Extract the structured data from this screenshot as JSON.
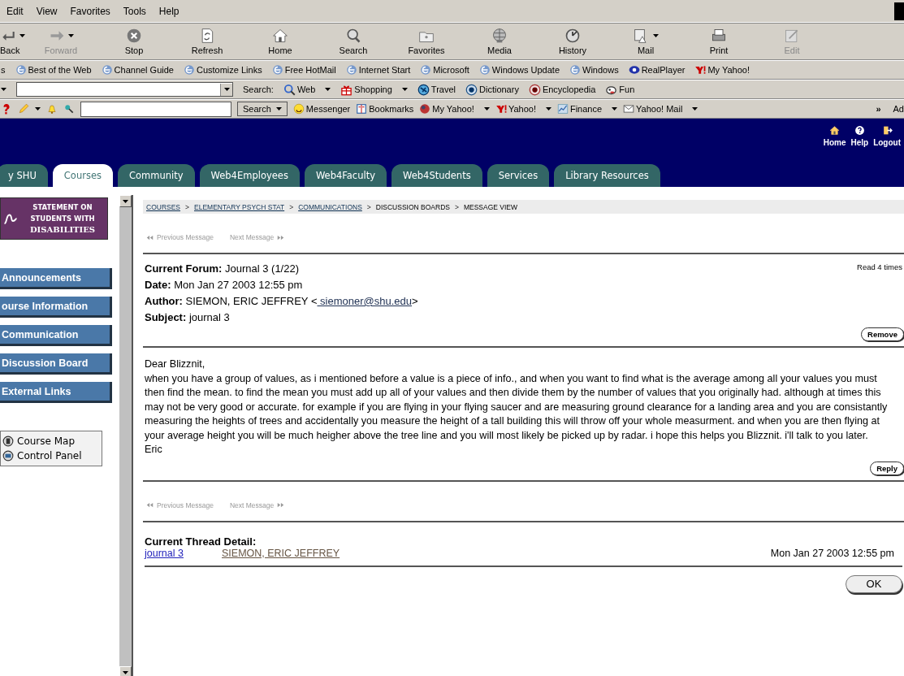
{
  "menu": [
    {
      "label": "Edit"
    },
    {
      "label": "View"
    },
    {
      "label": "Favorites"
    },
    {
      "label": "Tools"
    },
    {
      "label": "Help"
    }
  ],
  "toolbar": [
    {
      "label": "Back",
      "kind": "back",
      "disabled": false,
      "dropdown": true
    },
    {
      "label": "Forward",
      "kind": "forward",
      "disabled": true,
      "dropdown": true
    },
    {
      "label": "Stop",
      "kind": "stop",
      "disabled": false,
      "dropdown": false
    },
    {
      "label": "Refresh",
      "kind": "refresh",
      "disabled": false,
      "dropdown": false
    },
    {
      "label": "Home",
      "kind": "home",
      "disabled": false,
      "dropdown": false
    },
    {
      "label": "Search",
      "kind": "search",
      "disabled": false,
      "dropdown": false
    },
    {
      "label": "Favorites",
      "kind": "favorites",
      "disabled": false,
      "dropdown": false
    },
    {
      "label": "Media",
      "kind": "media",
      "disabled": false,
      "dropdown": false
    },
    {
      "label": "History",
      "kind": "history",
      "disabled": false,
      "dropdown": false
    },
    {
      "label": "Mail",
      "kind": "mail",
      "disabled": false,
      "dropdown": true
    },
    {
      "label": "Print",
      "kind": "print",
      "disabled": false,
      "dropdown": false
    },
    {
      "label": "Edit",
      "kind": "edit",
      "disabled": true,
      "dropdown": false
    }
  ],
  "links_bar": {
    "label": "s",
    "items": [
      {
        "label": "Best of the Web",
        "kind": "ie"
      },
      {
        "label": "Channel Guide",
        "kind": "ie"
      },
      {
        "label": "Customize Links",
        "kind": "ie"
      },
      {
        "label": "Free HotMail",
        "kind": "ie"
      },
      {
        "label": "Internet Start",
        "kind": "ie"
      },
      {
        "label": "Microsoft",
        "kind": "ie"
      },
      {
        "label": "Windows Update",
        "kind": "ie"
      },
      {
        "label": "Windows",
        "kind": "ie"
      },
      {
        "label": "RealPlayer",
        "kind": "real"
      },
      {
        "label": "My Yahoo!",
        "kind": "yahoo"
      }
    ]
  },
  "search_bar": {
    "label": "Search:",
    "items": [
      {
        "label": "Web",
        "kind": "magnifier",
        "dropdown": true
      },
      {
        "label": "Shopping",
        "kind": "gift",
        "dropdown": true
      },
      {
        "label": "Travel",
        "kind": "plane",
        "dropdown": false
      },
      {
        "label": "Dictionary",
        "kind": "dict",
        "dropdown": false
      },
      {
        "label": "Encyclopedia",
        "kind": "ency",
        "dropdown": false
      },
      {
        "label": "Fun",
        "kind": "fun",
        "dropdown": false
      }
    ]
  },
  "yahoo_bar": {
    "button": "Search",
    "items": [
      {
        "label": "Messenger",
        "kind": "smiley",
        "dropdown": false
      },
      {
        "label": "Bookmarks",
        "kind": "book",
        "dropdown": false
      },
      {
        "label": "My Yahoo!",
        "kind": "ball",
        "dropdown": true
      },
      {
        "label": "Yahoo!",
        "kind": "yahoo",
        "dropdown": true
      },
      {
        "label": "Finance",
        "kind": "finance",
        "dropdown": true
      },
      {
        "label": "Yahoo! Mail",
        "kind": "envelope",
        "dropdown": true
      }
    ],
    "more": "»",
    "cut": "Ad"
  },
  "portal": {
    "tabs": [
      {
        "label": "y SHU",
        "selected": false
      },
      {
        "label": "Courses",
        "selected": true
      },
      {
        "label": "Community",
        "selected": false
      },
      {
        "label": "Web4Employees",
        "selected": false
      },
      {
        "label": "Web4Faculty",
        "selected": false
      },
      {
        "label": "Web4Students",
        "selected": false
      },
      {
        "label": "Services",
        "selected": false
      },
      {
        "label": "Library Resources",
        "selected": false
      }
    ],
    "header_links": [
      {
        "label": "Home",
        "kind": "house"
      },
      {
        "label": "Help",
        "kind": "help"
      },
      {
        "label": "Logout",
        "kind": "logout"
      }
    ]
  },
  "sidebar": {
    "banner": [
      "STATEMENT ON",
      "STUDENTS WITH",
      "DISABILITIES"
    ],
    "nav": [
      {
        "label": "Announcements"
      },
      {
        "label": "ourse Information"
      },
      {
        "label": "Communication"
      },
      {
        "label": "Discussion Board"
      },
      {
        "label": "External Links"
      }
    ],
    "tools": [
      {
        "label": "Course Map",
        "kind": "map"
      },
      {
        "label": "Control Panel",
        "kind": "panel"
      }
    ]
  },
  "breadcrumb": [
    {
      "label": "COURSES",
      "link": true
    },
    {
      "sep": ">",
      "label": "ELEMENTARY PSYCH STAT",
      "link": true
    },
    {
      "sep": ">",
      "label": "COMMUNICATIONS",
      "link": true
    },
    {
      "sep": ">",
      "label": "DISCUSSION BOARDS",
      "link": false
    },
    {
      "sep": ">",
      "label": "MESSAGE VIEW",
      "link": false
    }
  ],
  "pager_top": [
    {
      "label": "Previous Message",
      "kind": "prev",
      "disabled": true
    },
    {
      "label": "Next Message",
      "kind": "next",
      "disabled": true
    }
  ],
  "message": {
    "fields": [
      {
        "label": "Current Forum:",
        "value": "Journal 3 (1/22)"
      },
      {
        "label": "Date:",
        "value": "Mon Jan 27 2003 12:55 pm"
      },
      {
        "label": "Author:",
        "value": "SIEMON, ERIC JEFFREY <",
        "link": " siemoner@shu.edu",
        "after": ">"
      },
      {
        "label": "Subject:",
        "value": "journal 3"
      }
    ],
    "read_count": "Read 4 times",
    "remove": "Remove",
    "greeting": "Dear Blizznit,",
    "body": "when you have a group of values, as i mentioned before a value is a piece of info., and when you want to find what is the average among all your values you must then find the mean. to find the mean you must add up all of your values and then divide them by the number of values that you originally had. although at times this may not be very good or accurate. for example if you are flying in your flying saucer and are measuring ground clearance for a landing area and you are consistantly measuring the heights of trees and accidentally you measure the height of a tall building this will throw off your whole measurment. and when you are then flying at your average height you will be much heigher above the tree line and you will most likely be picked up by radar. i hope this helps you Blizznit. i'll talk to you later.",
    "signature": "Eric",
    "reply": "Reply"
  },
  "pager_bottom": [
    {
      "label": "Previous Message",
      "kind": "prev",
      "disabled": true
    },
    {
      "label": "Next Message",
      "kind": "next",
      "disabled": true
    }
  ],
  "thread": {
    "title": "Current Thread Detail:",
    "rows": [
      {
        "subject": "journal 3",
        "author": "SIEMON, ERIC JEFFREY",
        "date": "Mon Jan 27 2003 12:55 pm"
      }
    ]
  },
  "ok": "OK"
}
